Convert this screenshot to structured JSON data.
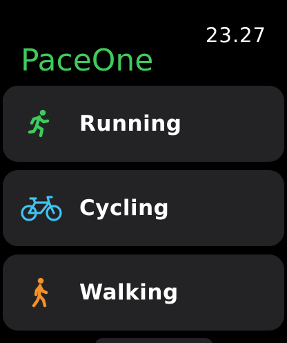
{
  "status": {
    "time": "23.27"
  },
  "app": {
    "title": "PaceOne",
    "accent": "#3fcb5c"
  },
  "activities": [
    {
      "label": "Running",
      "icon": "running-figure-icon",
      "color": "#3fcb5c"
    },
    {
      "label": "Cycling",
      "icon": "bicycle-icon",
      "color": "#3fc4f2"
    },
    {
      "label": "Walking",
      "icon": "walking-figure-icon",
      "color": "#f2922a"
    }
  ]
}
